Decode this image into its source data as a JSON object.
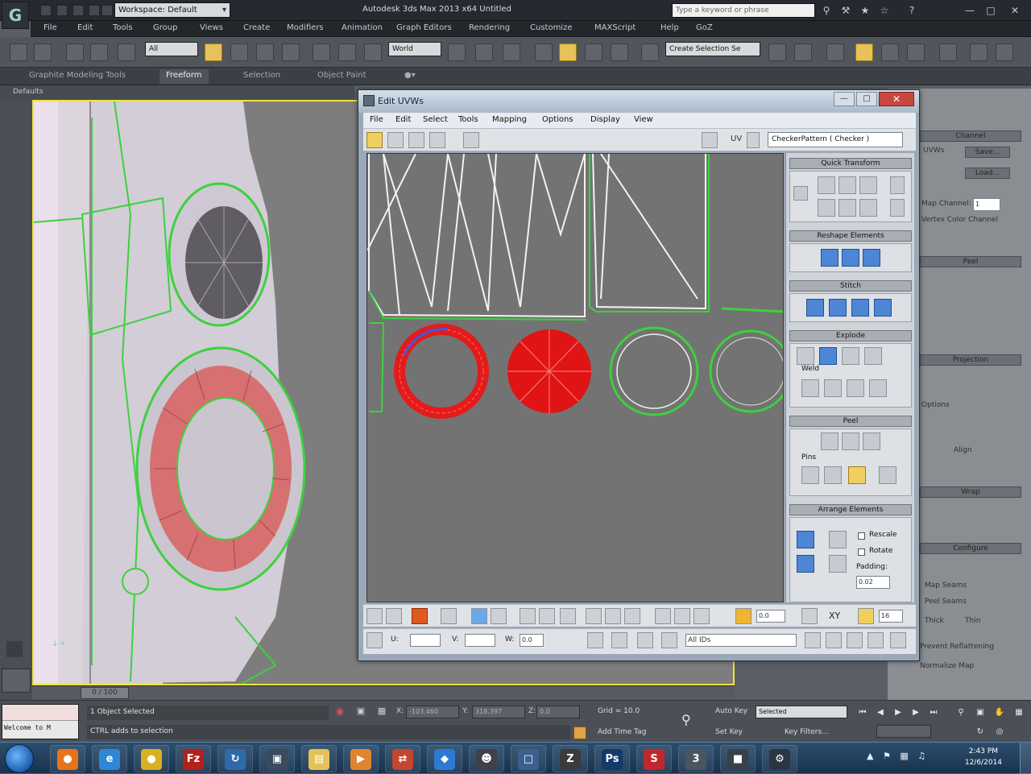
{
  "titlebar": {
    "workspace": "Workspace: Default",
    "app_title": "Autodesk 3ds Max  2013 x64      Untitled",
    "search_placeholder": "Type a keyword or phrase"
  },
  "menubar": [
    "File",
    "Edit",
    "Tools",
    "Group",
    "Views",
    "Create",
    "Modifiers",
    "Animation",
    "Graph Editors",
    "Rendering",
    "Customize",
    "MAXScript",
    "Help",
    "GoZ"
  ],
  "toolbar": {
    "filter": "All",
    "ref_coord": "World",
    "named_selection": "Create Selection Se"
  },
  "ribbon": {
    "tabs": [
      "Graphite Modeling Tools",
      "Freeform",
      "Selection",
      "Object Paint"
    ],
    "active": "Freeform",
    "sub_label": "Defaults"
  },
  "viewport": {
    "label": "0 / 100"
  },
  "uvw": {
    "title": "Edit UVWs",
    "menus": [
      "File",
      "Edit",
      "Select",
      "Tools",
      "Mapping",
      "Options",
      "Display",
      "View"
    ],
    "uv_label": "UV",
    "texture": "CheckerPattern  ( Checker )",
    "rollouts": {
      "quick_transform": "Quick Transform",
      "reshape": "Reshape Elements",
      "stitch": "Stitch",
      "explode": "Explode",
      "weld_label": "Weld",
      "peel": "Peel",
      "peel_sub": "Pins",
      "arrange": "Arrange Elements",
      "rescale": "Rescale",
      "rotate": "Rotate",
      "padding": "Padding:",
      "padding_value": "0.02"
    },
    "bottom": {
      "u_label": "U:",
      "v_label": "V:",
      "w_label": "W:",
      "w_value": "0.0",
      "id_filter": "All IDs",
      "spin_value": "0.0",
      "spin_value2": "16",
      "xy_label": "XY"
    }
  },
  "right_panel": {
    "channel": "Channel",
    "uvws": "UVWs",
    "save": "Save...",
    "load": "Load...",
    "map_channel": "Map Channel:",
    "map_channel_value": "1",
    "vertex_color": "Vertex Color Channel",
    "peel": "Peel",
    "projection": "Projection",
    "options": "Options",
    "align": "Align",
    "wrap": "Wrap",
    "configure": "Configure",
    "map_seams": "Map Seams",
    "peel_seams": "Peel Seams",
    "thick": "Thick",
    "thin": "Thin",
    "prevent_reflattening": "Prevent Reflattening",
    "normalize_map": "Normalize Map"
  },
  "status": {
    "selection": "1 Object Selected",
    "prompt": "CTRL adds to selection",
    "x_label": "X:",
    "x_value": "-103.460",
    "y_label": "Y:",
    "y_value": "318.397",
    "z_label": "Z:",
    "z_value": "0.0",
    "grid": "Grid = 10.0",
    "auto_key": "Auto Key",
    "auto_key_value": "Selected",
    "set_key": "Set Key",
    "key_filters": "Key Filters...",
    "add_time_tag": "Add Time Tag",
    "maxscript": "Welcome to M"
  },
  "taskbar": {
    "apps": [
      {
        "name": "firefox",
        "glyph": "●",
        "color": "#e8731d"
      },
      {
        "name": "internet-explorer",
        "glyph": "e",
        "color": "#2f86d4"
      },
      {
        "name": "chrome",
        "glyph": "●",
        "color": "#d9b021"
      },
      {
        "name": "filezilla",
        "glyph": "Fz",
        "color": "#b3211b"
      },
      {
        "name": "sync",
        "glyph": "↻",
        "color": "#2f6aa8"
      },
      {
        "name": "monitor",
        "glyph": "▣",
        "color": "#3b4a5e"
      },
      {
        "name": "explorer",
        "glyph": "▤",
        "color": "#e5c15a"
      },
      {
        "name": "media",
        "glyph": "▶",
        "color": "#e0852f"
      },
      {
        "name": "flashfxp",
        "glyph": "⇄",
        "color": "#c4462f"
      },
      {
        "name": "dropbox",
        "glyph": "◆",
        "color": "#2d79d3"
      },
      {
        "name": "anime",
        "glyph": "☻",
        "color": "#40404a"
      },
      {
        "name": "remote",
        "glyph": "□",
        "color": "#3c5f8f"
      },
      {
        "name": "zbrush",
        "glyph": "Z",
        "color": "#3b3b3b"
      },
      {
        "name": "photoshop",
        "glyph": "Ps",
        "color": "#133a6b"
      },
      {
        "name": "stop",
        "glyph": "S",
        "color": "#c1272d"
      },
      {
        "name": "3dsmax",
        "glyph": "3",
        "color": "#4a565f"
      },
      {
        "name": "app-dark",
        "glyph": "■",
        "color": "#38404a"
      },
      {
        "name": "settings",
        "glyph": "⚙",
        "color": "#2b3643"
      }
    ],
    "time": "2:43 PM",
    "date": "12/6/2014"
  }
}
